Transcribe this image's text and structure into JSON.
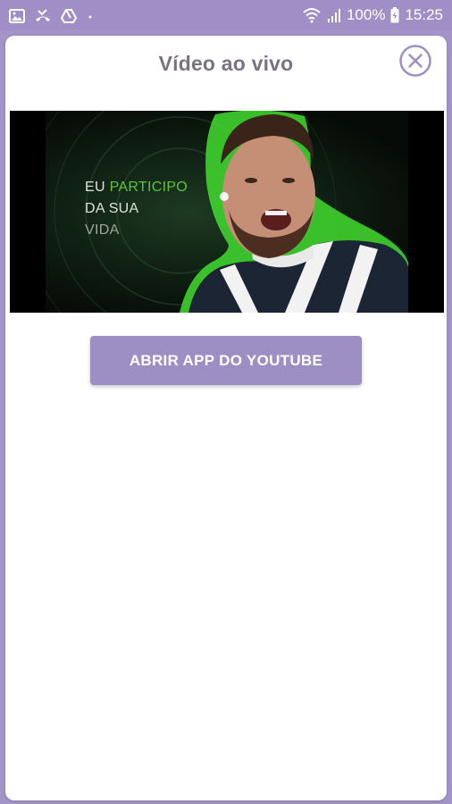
{
  "status_bar": {
    "battery": "100%",
    "time": "15:25",
    "icons": [
      "image-icon",
      "missed-call-icon",
      "drive-icon",
      "dot-icon",
      "wifi-icon",
      "signal-icon",
      "battery-icon"
    ]
  },
  "modal": {
    "title": "Vídeo ao vivo",
    "close_icon": "close-circle-icon"
  },
  "video": {
    "text_line1_part1": "EU ",
    "text_line1_part2": "PARTICIPO",
    "text_line2": "DA SUA",
    "text_line3": "VIDA"
  },
  "actions": {
    "open_youtube_label": "ABRIR APP DO YOUTUBE"
  },
  "colors": {
    "accent": "#a08fc7",
    "button": "#9d8fc3",
    "title_text": "#7a7383",
    "video_green": "#5ec43b"
  }
}
